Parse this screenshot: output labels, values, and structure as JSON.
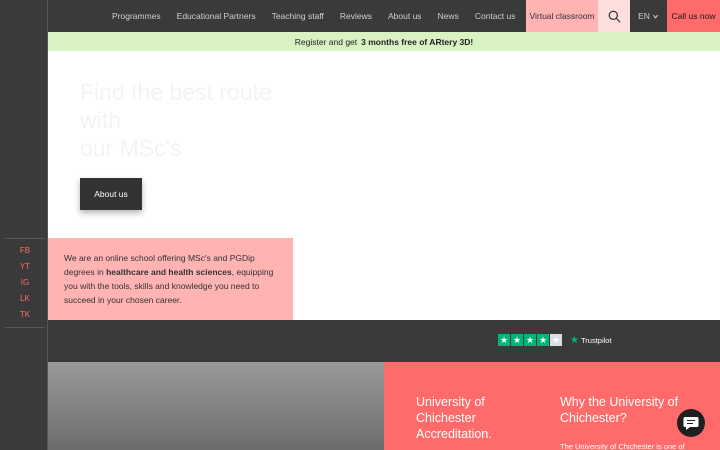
{
  "sidebar": {
    "social": [
      "FB",
      "YT",
      "IG",
      "LK",
      "TK"
    ]
  },
  "header": {
    "nav": [
      "Programmes",
      "Educational Partners",
      "Teaching staff",
      "Reviews",
      "About us",
      "News",
      "Contact us"
    ],
    "virtual_classroom": "Virtual classroom",
    "search_icon": "search-icon",
    "language": "EN",
    "call_now": "Call us now"
  },
  "promo": {
    "text": "Register and get",
    "highlight": "3 months free of ARtery 3D!"
  },
  "hero": {
    "title_line1": "Find the best route",
    "title_line2": "with",
    "title_line3": "our MSc's",
    "about_button": "About us"
  },
  "intro": {
    "text_before": "We are an online school offering MSc's and PGDip degrees in",
    "bold": "healthcare and health sciences",
    "text_after": ", equipping you with the tools, skills and knowledge you need to succeed in your chosen career."
  },
  "trustpilot": {
    "label": "Trustpilot",
    "rating_stars": 4,
    "max_stars": 5,
    "brand_color": "#00b67a"
  },
  "accreditation": {
    "title": "University of Chichester Accreditation.",
    "why_title": "Why the University of Chichester?",
    "why_text": "The University of Chichester is one of"
  },
  "colors": {
    "dark": "#3a3a3a",
    "coral": "#ff6b6b",
    "pink": "#ffb3b3",
    "green_banner": "#d9f2c4"
  }
}
